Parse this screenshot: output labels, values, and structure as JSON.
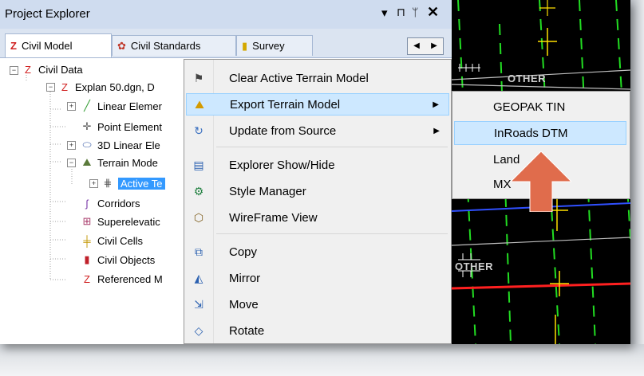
{
  "panel": {
    "title": "Project Explorer",
    "controls": [
      "▾",
      "⊓",
      "ᛘ",
      "✕"
    ]
  },
  "tabs": [
    {
      "label": "Civil Model",
      "icon": "civil-model-icon"
    },
    {
      "label": "Civil Standards",
      "icon": "civil-standards-icon"
    },
    {
      "label": "Survey",
      "icon": "survey-icon"
    }
  ],
  "tree": {
    "civil_data": "Civil Data",
    "file": "Explan 50.dgn, D",
    "linear_elements": "Linear Elemer",
    "point_elements": "Point Element",
    "linear_3d": "3D Linear Ele",
    "terrain_models": "Terrain Mode",
    "active_terrain": "Active Te",
    "corridors": "Corridors",
    "superelevation": "Superelevatic",
    "civil_cells": "Civil Cells",
    "civil_objects": "Civil Objects",
    "referenced": "Referenced M"
  },
  "context_menu": {
    "clear_active": "Clear Active Terrain Model",
    "export_terrain": "Export Terrain Model",
    "update_source": "Update from Source",
    "explorer_toggle": "Explorer Show/Hide",
    "style_manager": "Style Manager",
    "wireframe": "WireFrame View",
    "copy": "Copy",
    "mirror": "Mirror",
    "move": "Move",
    "rotate": "Rotate"
  },
  "submenu": {
    "geopak": "GEOPAK TIN",
    "inroads": "InRoads DTM",
    "landxml": "Land",
    "mx": "MX"
  },
  "cad_view": {
    "label_top": "OTHER",
    "label_bottom": "OTHER"
  },
  "colors": {
    "menu_highlight": "#cde8ff",
    "selection": "#3399ff",
    "annotation_arrow": "#e06c4c",
    "cad_green": "#22dd22",
    "cad_yellow": "#ffe000",
    "cad_red": "#ff2020"
  }
}
